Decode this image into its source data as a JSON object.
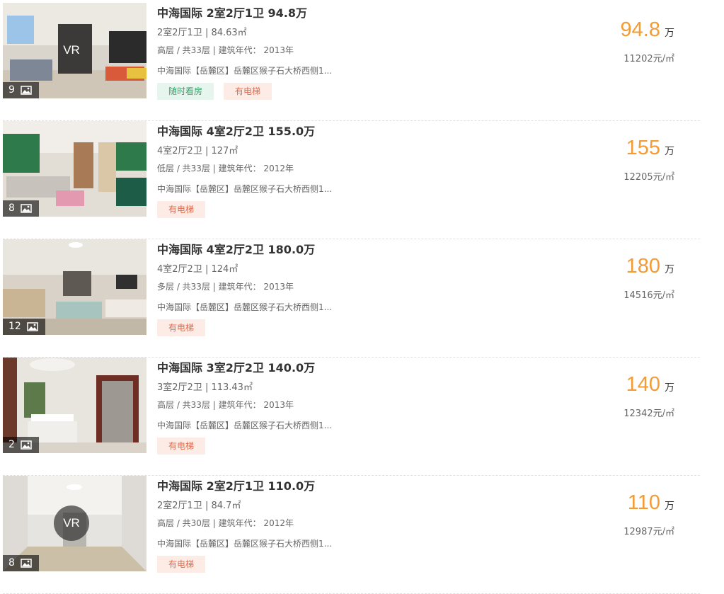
{
  "listings": [
    {
      "title": "中海国际 2室2厅1卫 94.8万",
      "house_info": "2室2厅1卫 | 84.63㎡",
      "floor_info": "高层 / 共33层 | 建筑年代： 2013年",
      "address": "中海国际【岳麓区】岳麓区猴子石大桥西侧1...",
      "photo_count": "9",
      "vr": "VR",
      "tags": [
        "随时看房",
        "有电梯"
      ],
      "total_price": "94.8",
      "price_unit": "万",
      "unit_price": "11202元/㎡"
    },
    {
      "title": "中海国际 4室2厅2卫 155.0万",
      "house_info": "4室2厅2卫 | 127㎡",
      "floor_info": "低层 / 共33层 | 建筑年代： 2012年",
      "address": "中海国际【岳麓区】岳麓区猴子石大桥西侧1...",
      "photo_count": "8",
      "tags": [
        "有电梯"
      ],
      "total_price": "155",
      "price_unit": "万",
      "unit_price": "12205元/㎡"
    },
    {
      "title": "中海国际 4室2厅2卫 180.0万",
      "house_info": "4室2厅2卫 | 124㎡",
      "floor_info": "多层 / 共33层 | 建筑年代： 2013年",
      "address": "中海国际【岳麓区】岳麓区猴子石大桥西侧1...",
      "photo_count": "12",
      "tags": [
        "有电梯"
      ],
      "total_price": "180",
      "price_unit": "万",
      "unit_price": "14516元/㎡"
    },
    {
      "title": "中海国际 3室2厅2卫 140.0万",
      "house_info": "3室2厅2卫 | 113.43㎡",
      "floor_info": "高层 / 共33层 | 建筑年代： 2013年",
      "address": "中海国际【岳麓区】岳麓区猴子石大桥西侧1...",
      "photo_count": "2",
      "tags": [
        "有电梯"
      ],
      "total_price": "140",
      "price_unit": "万",
      "unit_price": "12342元/㎡"
    },
    {
      "title": "中海国际 2室2厅1卫 110.0万",
      "house_info": "2室2厅1卫 | 84.7㎡",
      "floor_info": "高层 / 共30层 | 建筑年代： 2012年",
      "address": "中海国际【岳麓区】岳麓区猴子石大桥西侧1...",
      "photo_count": "8",
      "vr": "VR",
      "tags": [
        "有电梯"
      ],
      "total_price": "110",
      "price_unit": "万",
      "unit_price": "12987元/㎡"
    }
  ],
  "colors": {
    "price": "#f39b35",
    "tag_green_bg": "#e6f6ee",
    "tag_green_text": "#38a36b",
    "tag_pink_bg": "#fdece6",
    "tag_pink_text": "#e06a4c"
  }
}
